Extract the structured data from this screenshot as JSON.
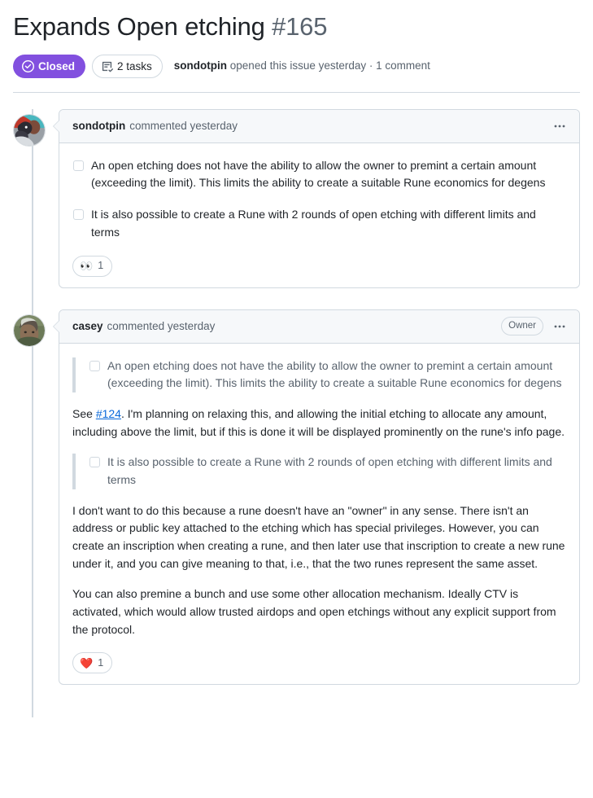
{
  "issue": {
    "title": "Expands Open etching",
    "number": "#165",
    "state_label": "Closed",
    "state_color": "#8250df",
    "tasks_label": "2 tasks",
    "meta_author": "sondotpin",
    "meta_text": " opened this issue yesterday · 1 comment"
  },
  "comments": [
    {
      "author": "sondotpin",
      "action": "commented yesterday",
      "badge": null,
      "menu": "•••",
      "tasks": [
        "An open etching does not have the ability to allow the owner to premint a certain amount (exceeding the limit). This limits the ability to create a suitable Rune economics for degens",
        "It is also possible to create a Rune with 2 rounds of open etching with different limits and terms"
      ],
      "reaction": {
        "emoji": "👀",
        "count": "1"
      }
    },
    {
      "author": "casey",
      "action": "commented yesterday",
      "badge": "Owner",
      "menu": "•••",
      "quote1": "An open etching does not have the ability to allow the owner to premint a certain amount (exceeding the limit). This limits the ability to create a suitable Rune economics for degens",
      "para1_pre": "See ",
      "para1_link": "#124",
      "para1_post": ". I'm planning on relaxing this, and allowing the initial etching to allocate any amount, including above the limit, but if this is done it will be displayed prominently on the rune's info page.",
      "quote2": "It is also possible to create a Rune with 2 rounds of open etching with different limits and terms",
      "para2": "I don't want to do this because a rune doesn't have an \"owner\" in any sense. There isn't an address or public key attached to the etching which has special privileges. However, you can create an inscription when creating a rune, and then later use that inscription to create a new rune under it, and you can give meaning to that, i.e., that the two runes represent the same asset.",
      "para3": "You can also premine a bunch and use some other allocation mechanism. Ideally CTV is activated, which would allow trusted airdops and open etchings without any explicit support from the protocol.",
      "reaction": {
        "emoji": "❤️",
        "count": "1"
      }
    }
  ]
}
